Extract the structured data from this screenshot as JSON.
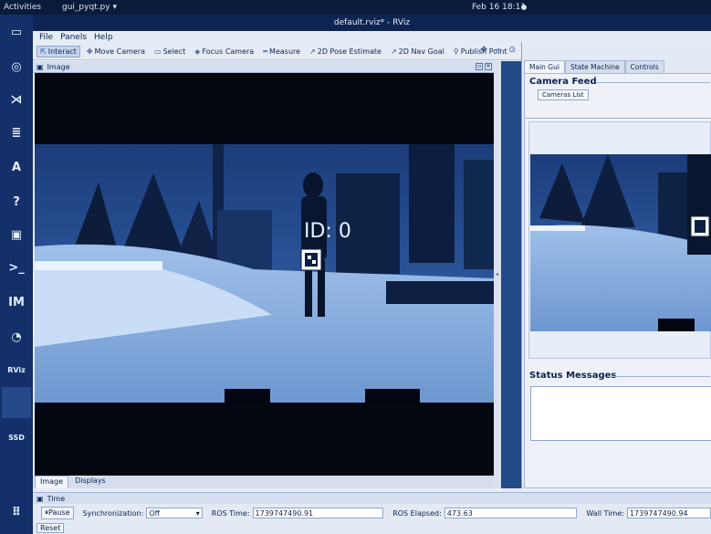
{
  "topbar": {
    "activities": "Activities",
    "app_menu": "gui_pyqt.py ▾",
    "clock": "Feb 16  18:11"
  },
  "dock": [
    {
      "name": "files-icon",
      "glyph": "▭"
    },
    {
      "name": "chrome-icon",
      "glyph": "◎"
    },
    {
      "name": "vscode-icon",
      "glyph": "⋊"
    },
    {
      "name": "text-editor-icon",
      "glyph": "≣"
    },
    {
      "name": "app-store-icon",
      "glyph": "A"
    },
    {
      "name": "help-icon",
      "glyph": "?"
    },
    {
      "name": "system-monitor-icon",
      "glyph": "▣"
    },
    {
      "name": "terminal-icon",
      "glyph": ">_"
    },
    {
      "name": "impress-icon",
      "glyph": "IM"
    },
    {
      "name": "obs-icon",
      "glyph": "◔"
    },
    {
      "name": "rviz-icon",
      "glyph": "RViz"
    },
    {
      "name": "ssd-icon",
      "glyph": "SSD"
    },
    {
      "name": "app-grid-icon",
      "glyph": "⠿"
    }
  ],
  "window": {
    "title": "default.rviz* - RViz"
  },
  "menu": {
    "file": "File",
    "panels": "Panels",
    "help": "Help"
  },
  "toolbar": {
    "interact": "Interact",
    "move_camera": "Move Camera",
    "select": "Select",
    "focus_camera": "Focus Camera",
    "measure": "Measure",
    "pose_estimate": "2D Pose Estimate",
    "nav_goal": "2D Nav Goal",
    "publish_point": "Publish Point"
  },
  "image_panel": {
    "title": "Image",
    "overlay_text": "ID: 0"
  },
  "bottom_tabs": {
    "image": "Image",
    "displays": "Displays"
  },
  "right_panel": {
    "tabs": [
      "Main Gui",
      "State Machine",
      "Controls"
    ],
    "camera_feed_title": "Camera Feed",
    "cameras_list": "Cameras List",
    "status_title": "Status Messages"
  },
  "time": {
    "title": "Time",
    "pause": "Pause",
    "sync_label": "Synchronization:",
    "sync_value": "Off",
    "ros_time_label": "ROS Time:",
    "ros_time": "1739747490.91",
    "ros_elapsed_label": "ROS Elapsed:",
    "ros_elapsed": "473.63",
    "wall_time_label": "Wall Time:",
    "wall_time": "1739747490.94",
    "reset": "Reset"
  },
  "colors": {
    "accent": "#1a3a6e",
    "panel": "#e6ecf5",
    "night": "#030814"
  }
}
